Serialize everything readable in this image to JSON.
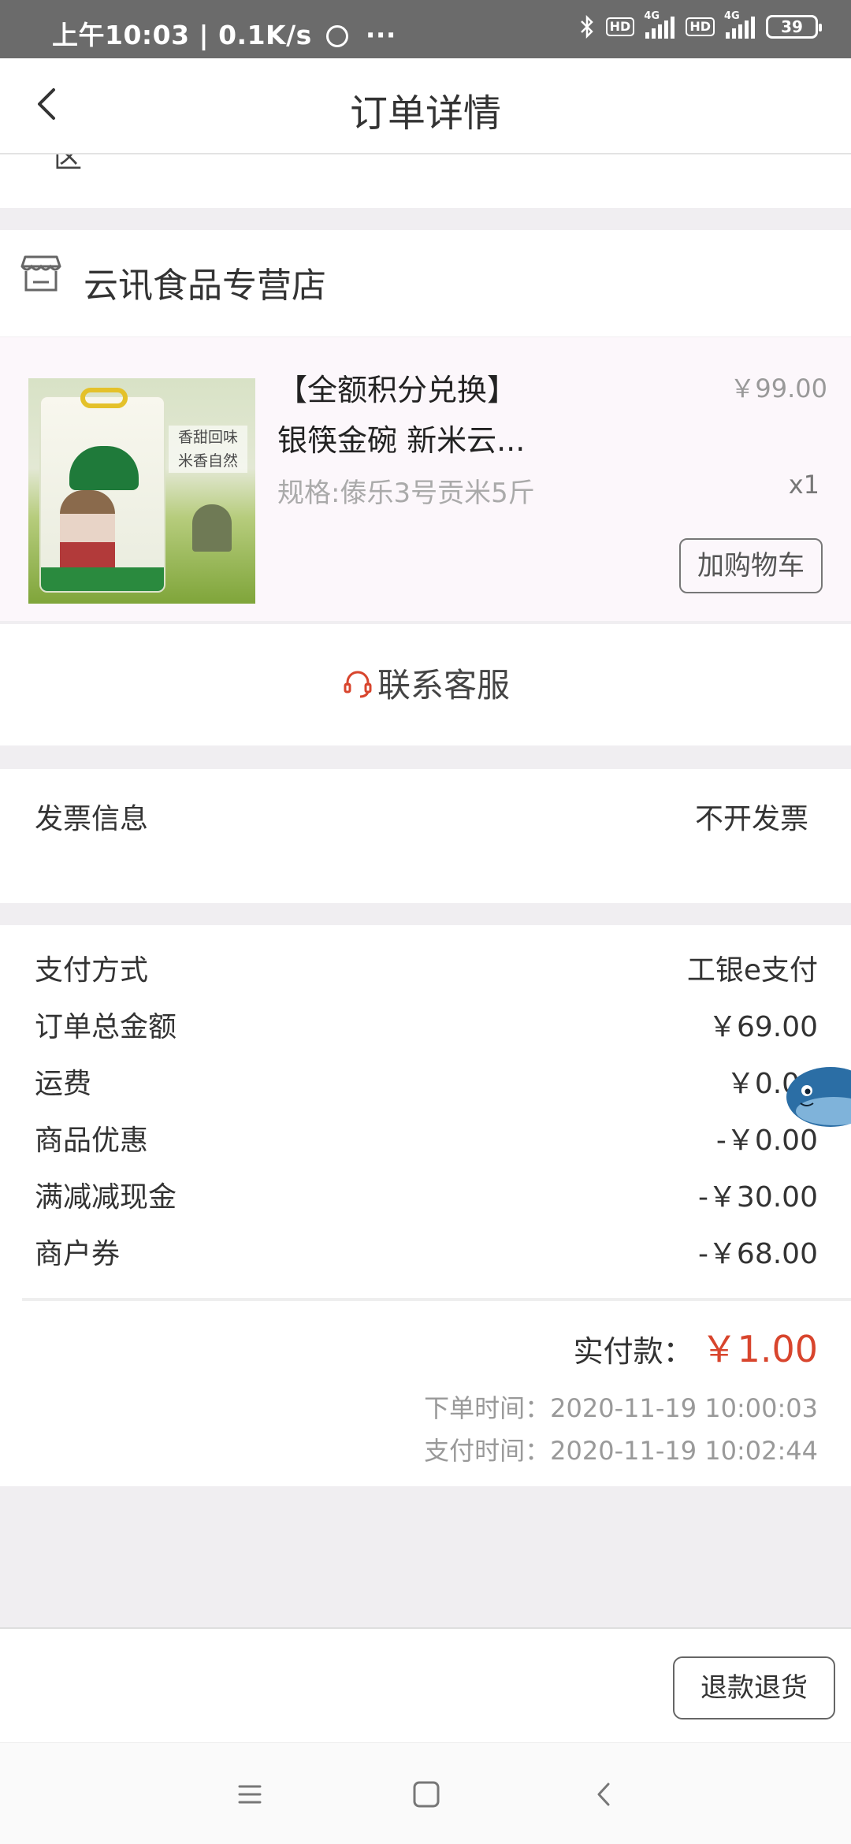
{
  "status_bar": {
    "left_text": "上午10:03 | 0.1K/s",
    "network_1": "HD",
    "network_2": "HD",
    "signal_type_1": "4G",
    "signal_type_2": "4G",
    "battery": "39"
  },
  "header": {
    "title": "订单详情"
  },
  "address_tail": {
    "stub": "区"
  },
  "shop": {
    "name": "云讯食品专营店"
  },
  "product": {
    "tag": "【全额积分兑换】",
    "name": "银筷金碗 新米云...",
    "spec": "规格:傣乐3号贡米5斤",
    "price": "￥99.00",
    "quantity": "x1",
    "add_cart_label": "加购物车",
    "image_slogan": "香甜回味 米香自然"
  },
  "service": {
    "label": "联系客服"
  },
  "invoice": {
    "label": "发票信息",
    "value": "不开发票"
  },
  "payment": {
    "rows": [
      {
        "label": "支付方式",
        "value": "工银e支付"
      },
      {
        "label": "订单总金额",
        "value": "￥69.00"
      },
      {
        "label": "运费",
        "value": "￥0.00"
      },
      {
        "label": "商品优惠",
        "value": "-￥0.00"
      },
      {
        "label": "满减减现金",
        "value": "-￥30.00"
      },
      {
        "label": "商户券",
        "value": "-￥68.00"
      }
    ],
    "paid_label": "实付款：",
    "paid_value": "￥1.00",
    "order_time": "下单时间：2020-11-19 10:00:03",
    "pay_time": "支付时间：2020-11-19 10:02:44"
  },
  "bottom": {
    "refund_label": "退款退货"
  },
  "colors": {
    "accent_red": "#d8452d",
    "product_bg": "#fcf7fb",
    "page_bg": "#f0eef1"
  }
}
